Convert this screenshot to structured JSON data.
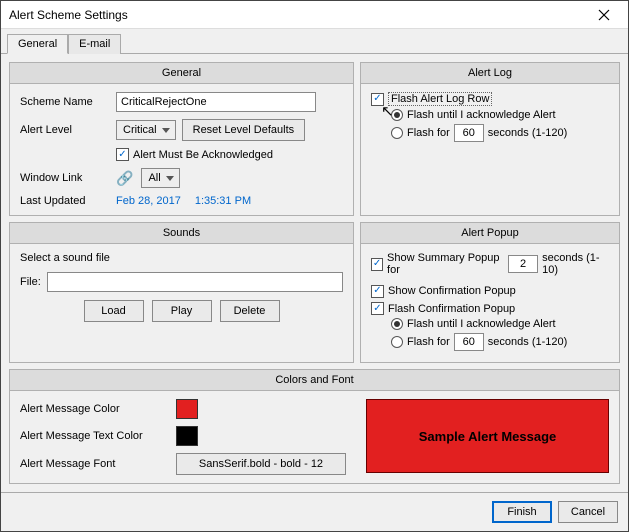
{
  "window": {
    "title": "Alert Scheme Settings"
  },
  "tabs": {
    "general": "General",
    "email": "E-mail"
  },
  "general": {
    "title": "General",
    "scheme_name_label": "Scheme Name",
    "scheme_name_value": "CriticalRejectOne",
    "alert_level_label": "Alert Level",
    "alert_level_value": "Critical",
    "reset_defaults": "Reset Level Defaults",
    "must_ack": "Alert Must Be Acknowledged",
    "window_link_label": "Window Link",
    "window_link_value": "All",
    "last_updated_label": "Last Updated",
    "last_updated_date": "Feb 28, 2017",
    "last_updated_time": "1:35:31 PM"
  },
  "alertlog": {
    "title": "Alert Log",
    "flash_row": "Flash Alert Log Row",
    "flash_until": "Flash until I acknowledge Alert",
    "flash_for_prefix": "Flash for",
    "flash_for_value": "60",
    "flash_for_suffix": "seconds (1-120)"
  },
  "sounds": {
    "title": "Sounds",
    "select_file": "Select a sound file",
    "file_label": "File:",
    "file_value": "",
    "load": "Load",
    "play": "Play",
    "delete": "Delete"
  },
  "alertpopup": {
    "title": "Alert Popup",
    "summary_prefix": "Show Summary Popup for",
    "summary_value": "2",
    "summary_suffix": "seconds (1-10)",
    "show_confirm": "Show Confirmation Popup",
    "flash_confirm": "Flash Confirmation Popup",
    "flash_until": "Flash until I acknowledge Alert",
    "flash_for_prefix": "Flash for",
    "flash_for_value": "60",
    "flash_for_suffix": "seconds (1-120)"
  },
  "colors": {
    "title": "Colors and Font",
    "msg_color_label": "Alert Message Color",
    "msg_color": "#e22020",
    "text_color_label": "Alert Message Text Color",
    "text_color": "#000000",
    "font_label": "Alert Message Font",
    "font_value": "SansSerif.bold - bold - 12",
    "sample": "Sample Alert Message"
  },
  "footer": {
    "finish": "Finish",
    "cancel": "Cancel"
  }
}
